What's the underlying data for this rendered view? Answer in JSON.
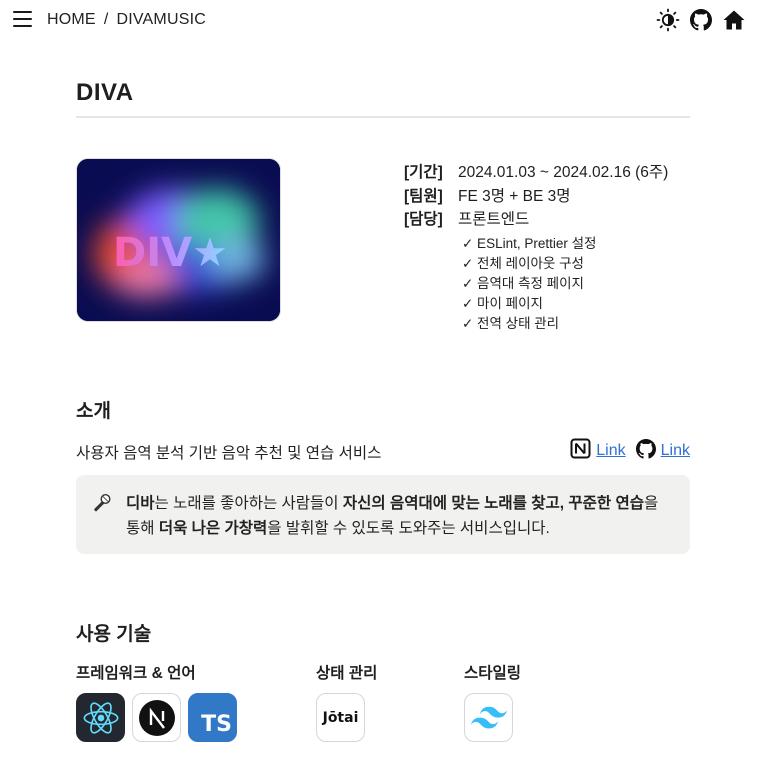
{
  "nav": {
    "home": "HOME",
    "separator": "/",
    "current": "DIVAMUSIC",
    "icons": [
      "menu-icon",
      "theme-toggle-icon",
      "github-icon",
      "home-icon"
    ]
  },
  "project": {
    "title": "DIVA",
    "thumbnail_text": "DIV★",
    "period_label": "[기간]",
    "period": "2024.01.03 ~ 2024.02.16 (6주)",
    "team_label": "[팀원]",
    "team": "FE 3명 + BE 3명",
    "role_label": "[담당]",
    "role": "프론트엔드",
    "tasks": [
      "✓ ESLint, Prettier 설정",
      "✓ 전체 레이아웃 구성",
      "✓ 음역대 측정 페이지",
      "✓ 마이 페이지",
      "✓ 전역 상태 관리"
    ]
  },
  "intro": {
    "title": "소개",
    "summary": "사용자 음역 분석 기반 음악 추천 및 연습 서비스",
    "notion_link": "Link",
    "github_link": "Link",
    "callout": {
      "p1": "디바",
      "p2": "는 노래를 좋아하는 사람들이 ",
      "p3": "자신의 음역대에 맞는 노래를 찾고, 꾸준한 연습",
      "p4": "을 통해 ",
      "p5": "더욱 나은 가창력",
      "p6": "을 발휘할 수 있도록 도와주는 서비스입니다."
    }
  },
  "tech": {
    "title": "사용 기술",
    "framework_label": "프레임워크 & 언어",
    "state_label": "상태 관리",
    "style_label": "스타일링",
    "jotai_text": "Jōtai",
    "ts_text": "TS"
  },
  "colors": {
    "link": "#2f6fd6",
    "callout_bg": "#f1f1ef",
    "thumb_bg": "#0a0c52",
    "react_cyan": "#61dafb",
    "ts_blue": "#3178c6",
    "tailwind": "#38bdf8"
  }
}
